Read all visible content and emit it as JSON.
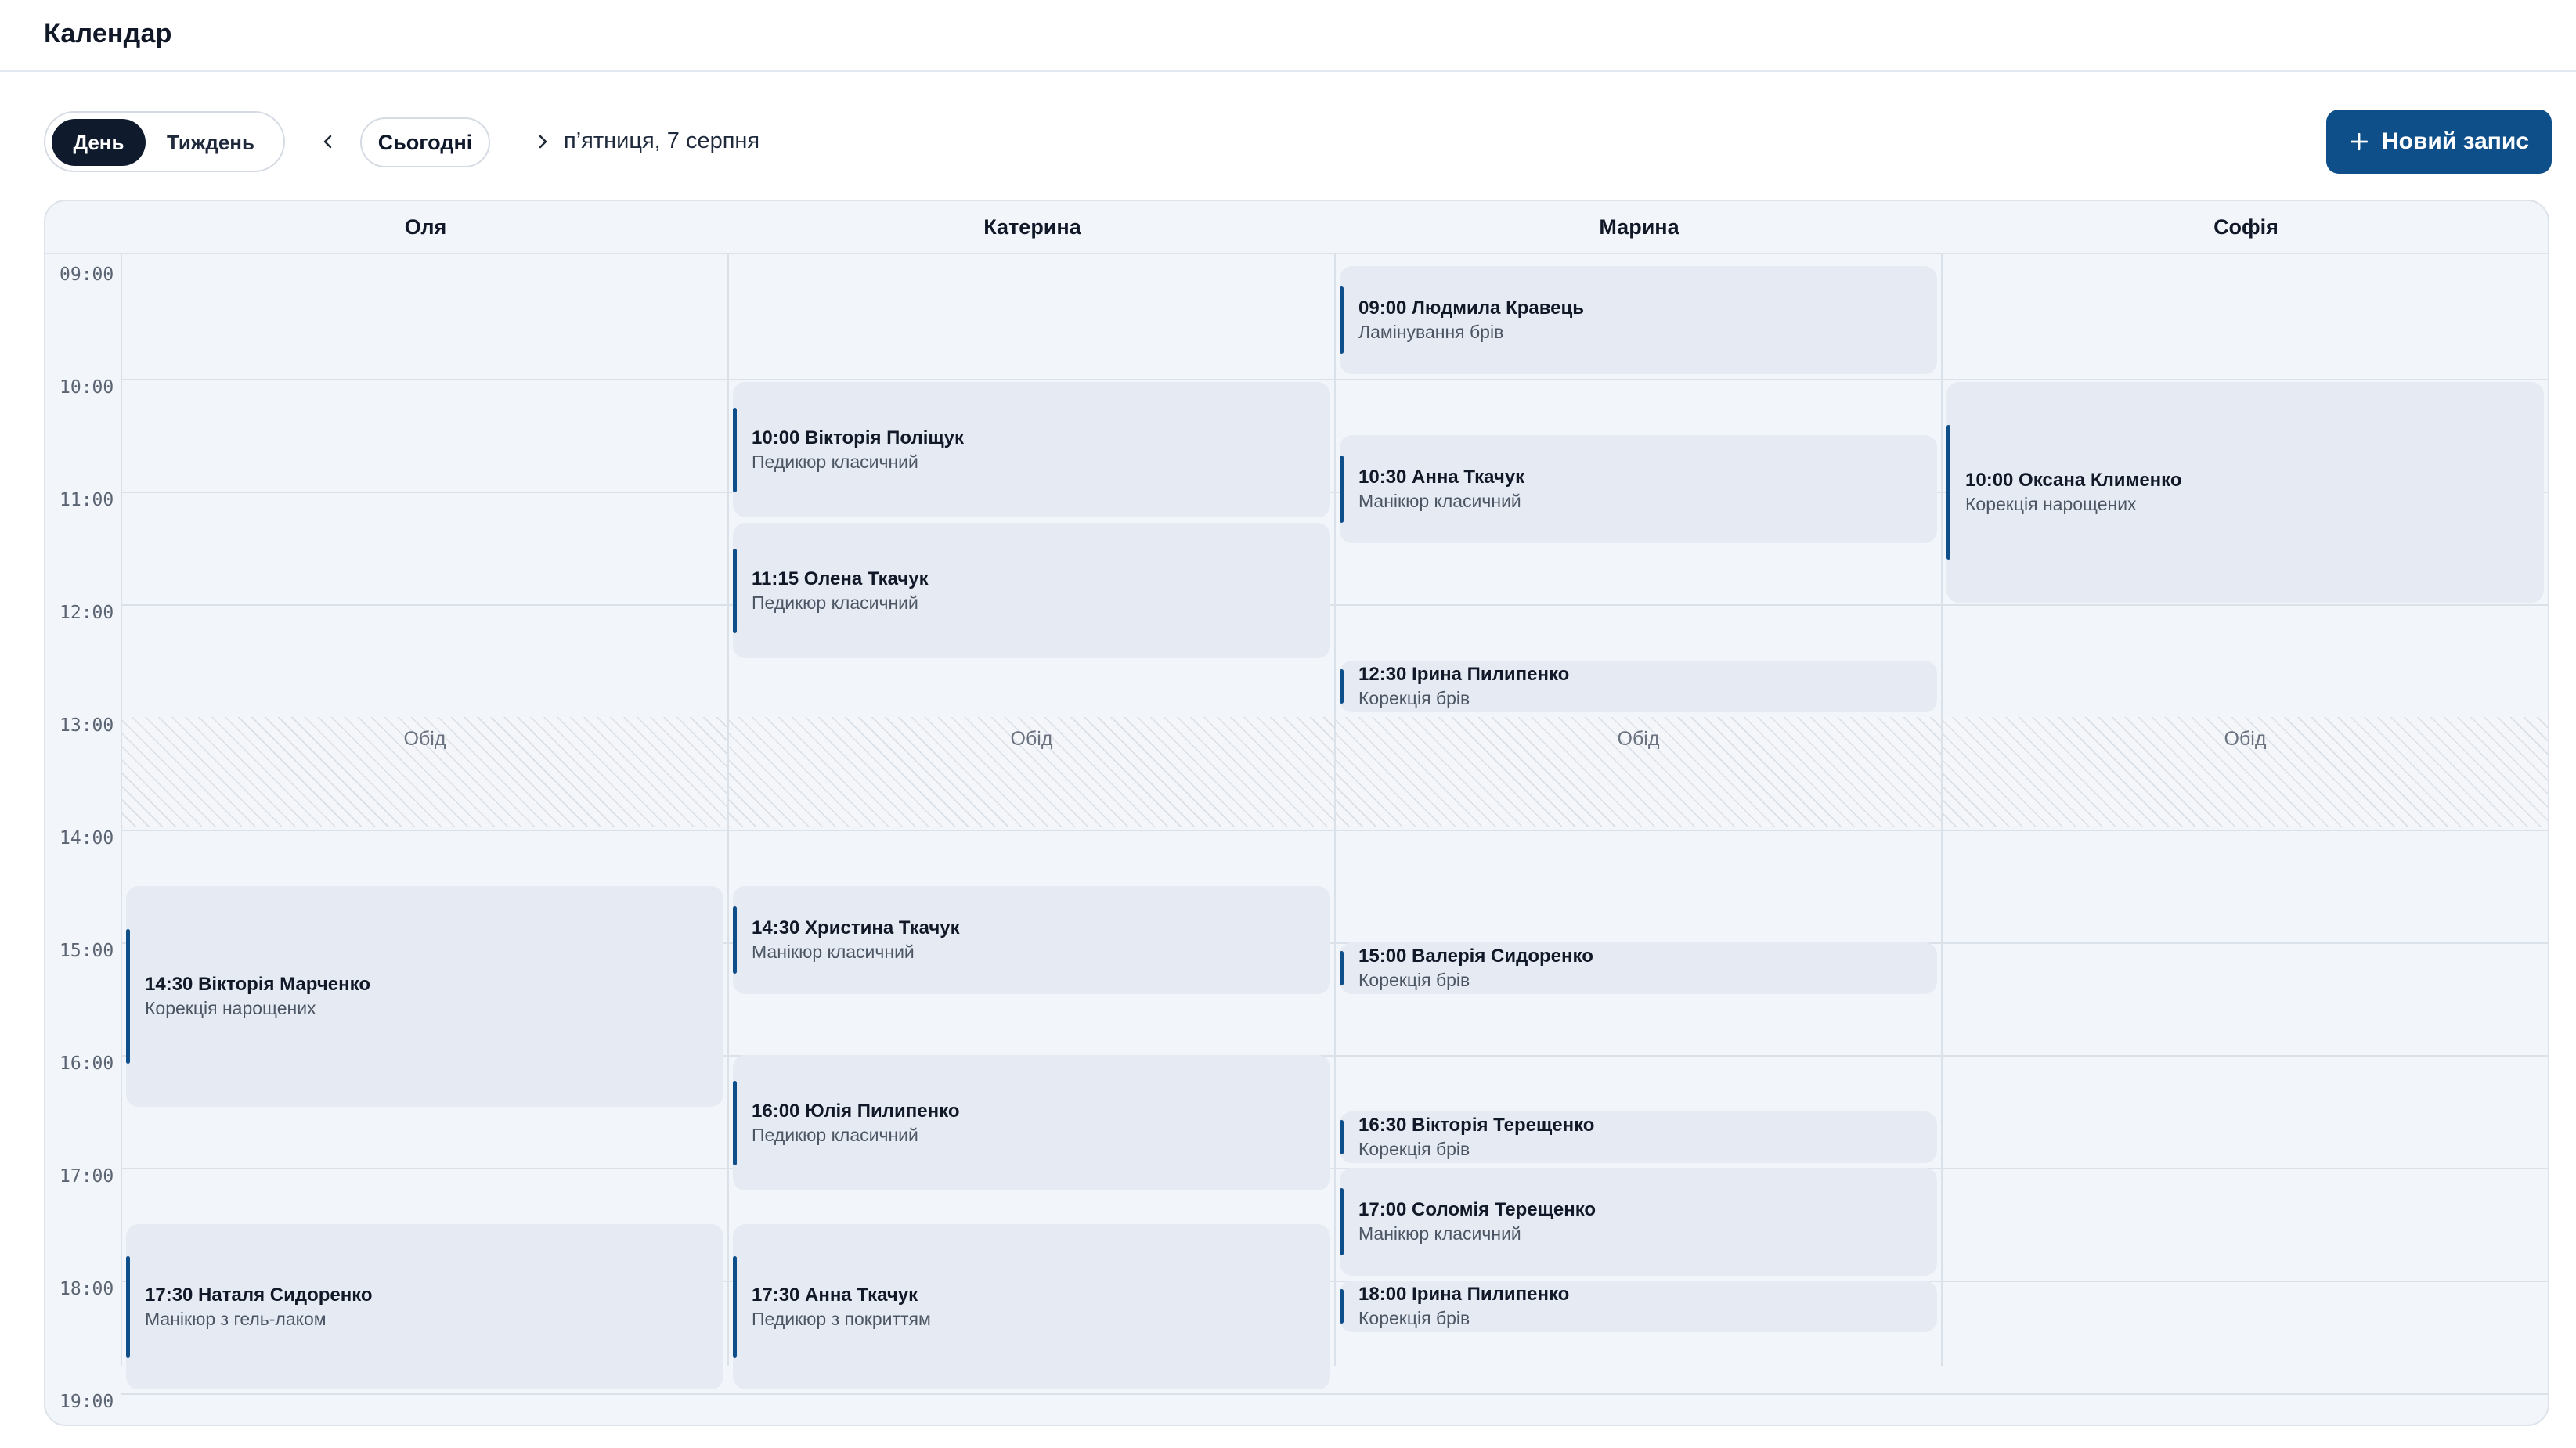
{
  "app": {
    "title": "Календар"
  },
  "toolbar": {
    "view_day": "День",
    "view_week": "Тиждень",
    "today": "Сьогодні",
    "date": "п’ятниця, 7 серпня",
    "new_entry": "Новий запис"
  },
  "calendar": {
    "staff": [
      "Оля",
      "Катерина",
      "Марина",
      "Софія"
    ],
    "hours": [
      "09:00",
      "10:00",
      "11:00",
      "12:00",
      "13:00",
      "14:00",
      "15:00",
      "16:00",
      "17:00",
      "18:00",
      "19:00"
    ],
    "lunch_label": "Обід",
    "events": {
      "olya_1": {
        "title": "14:30 Вікторія Марченко",
        "service": "Корекція нарощених"
      },
      "olya_2": {
        "title": "17:30 Наталя Сидоренко",
        "service": "Манікюр з гель-лаком"
      },
      "kateryna_1": {
        "title": "10:00 Вікторія Поліщук",
        "service": "Педикюр класичний"
      },
      "kateryna_2": {
        "title": "11:15 Олена Ткачук",
        "service": "Педикюр класичний"
      },
      "kateryna_3": {
        "title": "14:30 Христина Ткачук",
        "service": "Манікюр класичний"
      },
      "kateryna_4": {
        "title": "16:00 Юлія Пилипенко",
        "service": "Педикюр класичний"
      },
      "kateryna_5": {
        "title": "17:30 Анна Ткачук",
        "service": "Педикюр з покриттям"
      },
      "maryna_1": {
        "title": "09:00 Людмила Кравець",
        "service": "Ламінування брів"
      },
      "maryna_2": {
        "title": "10:30 Анна Ткачук",
        "service": "Манікюр класичний"
      },
      "maryna_3": {
        "title": "12:30 Ірина Пилипенко",
        "service": "Корекція брів"
      },
      "maryna_4": {
        "title": "15:00 Валерія Сидоренко",
        "service": "Корекція брів"
      },
      "maryna_5": {
        "title": "16:30 Вікторія Терещенко",
        "service": "Корекція брів"
      },
      "maryna_6": {
        "title": "17:00 Соломія Терещенко",
        "service": "Манікюр класичний"
      },
      "maryna_7": {
        "title": "18:00 Ірина Пилипенко",
        "service": "Корекція брів"
      },
      "sofia_1": {
        "title": "10:00 Оксана Клименко",
        "service": "Корекція нарощених"
      }
    }
  },
  "colors": {
    "accent": "#0e4f8a",
    "event_bg": "#e6ebf3",
    "grid_bg": "#f2f5f9",
    "dark_pill": "#0f1b2d"
  },
  "icons": {
    "prev": "chevron-left-icon",
    "next": "chevron-right-icon",
    "add": "plus-icon"
  }
}
